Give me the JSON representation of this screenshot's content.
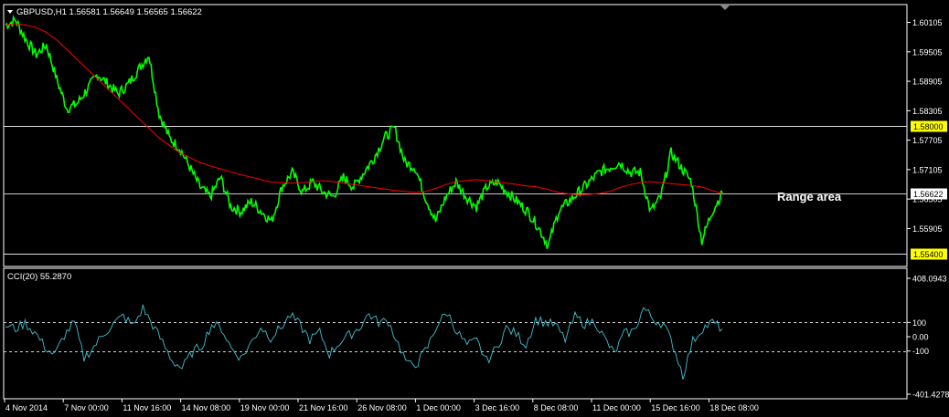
{
  "window": {
    "symbol_header": "GBPUSD,H1  1.56581 1.56649 1.56565 1.56622",
    "annotation": "Range area"
  },
  "chart_data": [
    {
      "type": "line",
      "title": "GBPUSD,H1",
      "ohlc": {
        "open": 1.56581,
        "high": 1.56649,
        "low": 1.56565,
        "close": 1.56622
      },
      "ylim": [
        1.5515,
        1.6045
      ],
      "yticks": [
        1.60105,
        1.59505,
        1.58905,
        1.58305,
        1.57705,
        1.57105,
        1.56505,
        1.55905
      ],
      "ytick_labels": [
        "1.60105",
        "1.59505",
        "1.58905",
        "1.58305",
        "1.57705",
        "1.57105",
        "1.56505",
        "1.55905"
      ],
      "xtick_labels": [
        "4 Nov 2014",
        "7 Nov 00:00",
        "11 Nov 16:00",
        "14 Nov 08:00",
        "19 Nov 00:00",
        "21 Nov 16:00",
        "26 Nov 08:00",
        "1 Dec 00:00",
        "3 Dec 16:00",
        "8 Dec 08:00",
        "11 Dec 00:00",
        "15 Dec 16:00",
        "18 Dec 08:00"
      ],
      "hlines": [
        {
          "value": 1.58,
          "label": "1.58000",
          "color": "#ffff00"
        },
        {
          "value": 1.5662,
          "label": "1.56622",
          "color": "#ffffff"
        },
        {
          "value": 1.554,
          "label": "1.55400",
          "color": "#ffff00"
        }
      ],
      "series": [
        {
          "role": "price",
          "color": "#00ff00",
          "values": [
            1.6005,
            1.6015,
            1.5975,
            1.5945,
            1.5965,
            1.5895,
            1.5835,
            1.5845,
            1.5875,
            1.5905,
            1.5885,
            1.5865,
            1.5885,
            1.5915,
            1.5945,
            1.5825,
            1.5775,
            1.5755,
            1.5715,
            1.5675,
            1.5655,
            1.5695,
            1.5635,
            1.5625,
            1.5645,
            1.5625,
            1.5605,
            1.5675,
            1.5705,
            1.5665,
            1.5685,
            1.5665,
            1.5655,
            1.5695,
            1.5675,
            1.5705,
            1.5735,
            1.5775,
            1.5795,
            1.5725,
            1.5715,
            1.5655,
            1.5605,
            1.5655,
            1.5685,
            1.5655,
            1.5635,
            1.5675,
            1.5685,
            1.5665,
            1.5645,
            1.5625,
            1.5595,
            1.5555,
            1.5625,
            1.5645,
            1.5665,
            1.5685,
            1.5705,
            1.5715,
            1.5725,
            1.5705,
            1.5705,
            1.5625,
            1.5655,
            1.5745,
            1.5715,
            1.5685,
            1.5565,
            1.5625,
            1.5662
          ]
        },
        {
          "role": "moving-average",
          "color": "#ff0000",
          "values": [
            1.6005,
            1.6008,
            1.6005,
            1.6,
            1.599,
            1.5975,
            1.5955,
            1.5935,
            1.5915,
            1.5895,
            1.5875,
            1.5855,
            1.5835,
            1.5815,
            1.5795,
            1.5775,
            1.576,
            1.5745,
            1.5735,
            1.5725,
            1.5718,
            1.5712,
            1.5706,
            1.57,
            1.5695,
            1.569,
            1.5685,
            1.5684,
            1.5683,
            1.5684,
            1.5686,
            1.5688,
            1.5686,
            1.5683,
            1.568,
            1.5677,
            1.5674,
            1.5671,
            1.5668,
            1.5666,
            1.5664,
            1.5666,
            1.5672,
            1.568,
            1.5686,
            1.5688,
            1.569,
            1.5688,
            1.5685,
            1.5683,
            1.568,
            1.5677,
            1.5675,
            1.567,
            1.5664,
            1.5661,
            1.5659,
            1.566,
            1.5662,
            1.5666,
            1.5674,
            1.568,
            1.5684,
            1.5686,
            1.5684,
            1.5682,
            1.568,
            1.5678,
            1.5675,
            1.5668,
            1.5662
          ]
        }
      ]
    },
    {
      "type": "line",
      "title": "CCI(20) 55.2870",
      "ylim": [
        -401.4278,
        408.0943
      ],
      "ytick_labels": [
        "408.0943",
        "100",
        "0.00",
        "-100",
        "-401.4278"
      ],
      "levels": [
        100,
        -100
      ],
      "series": [
        {
          "role": "cci",
          "color": "#40c0d0",
          "values": [
            80,
            55,
            95,
            30,
            -70,
            -130,
            10,
            100,
            -150,
            -70,
            20,
            90,
            145,
            75,
            200,
            80,
            -40,
            -170,
            -220,
            -110,
            -60,
            85,
            60,
            -80,
            -150,
            -45,
            70,
            -5,
            60,
            150,
            80,
            -20,
            30,
            -120,
            -40,
            10,
            60,
            160,
            100,
            110,
            -50,
            -200,
            -180,
            -70,
            90,
            170,
            35,
            -60,
            -30,
            -170,
            -80,
            60,
            20,
            -55,
            120,
            100,
            80,
            -20,
            140,
            90,
            110,
            -10,
            -120,
            20,
            40,
            200,
            120,
            90,
            -60,
            -270,
            -30,
            60,
            100,
            55
          ]
        }
      ]
    }
  ]
}
